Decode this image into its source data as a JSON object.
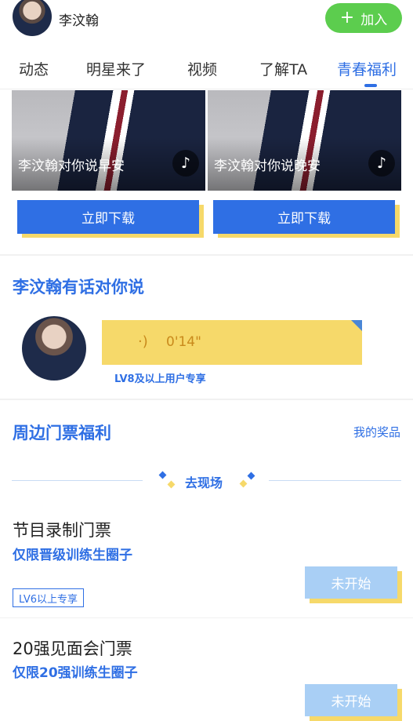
{
  "header": {
    "name": "李汶翰",
    "join_label": "加入",
    "join_icon": "plus-icon"
  },
  "tabs": [
    {
      "label": "动态",
      "active": false
    },
    {
      "label": "明星来了",
      "active": false
    },
    {
      "label": "视频",
      "active": false
    },
    {
      "label": "了解TA",
      "active": false
    },
    {
      "label": "青春福利",
      "active": true
    }
  ],
  "photos": [
    {
      "caption": "李汶翰对你说早安",
      "icon": "tiktok-note-icon",
      "download_label": "立即下载"
    },
    {
      "caption": "李汶翰对你说晚安",
      "icon": "tiktok-note-icon",
      "download_label": "立即下载"
    }
  ],
  "voice": {
    "title": "李汶翰有话对你说",
    "duration": "0'14\"",
    "icon": "sound-wave-icon",
    "note": "LV8及以上用户专享"
  },
  "tickets": {
    "title": "周边门票福利",
    "my_prize": "我的奖品",
    "go_label": "去现场",
    "items": [
      {
        "title": "节目录制门票",
        "sub": "仅限晋级训练生圈子",
        "tag": "LV6以上专享",
        "state": "未开始"
      },
      {
        "title": "20强见面会门票",
        "sub": "仅限20强训练生圈子",
        "tag": "",
        "state": "未开始"
      }
    ]
  },
  "colors": {
    "accent": "#2f6fe4",
    "join_green": "#5ccd4e",
    "bubble_yellow": "#f6d96a",
    "disabled_blue": "#a9cff5"
  }
}
